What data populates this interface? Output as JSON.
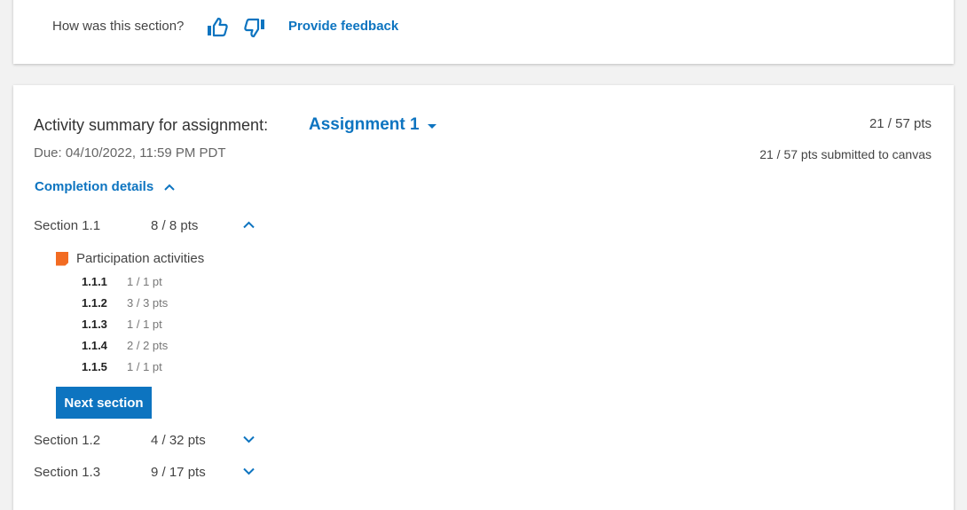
{
  "feedback": {
    "question": "How was this section?",
    "link": "Provide feedback"
  },
  "summary": {
    "label": "Activity summary for assignment:",
    "assignment": "Assignment 1",
    "total": "21 / 57 pts",
    "due": "Due: 04/10/2022, 11:59 PM PDT",
    "submitted": "21 / 57 pts submitted to canvas",
    "completion_toggle": "Completion details"
  },
  "sections": [
    {
      "name": "Section 1.1",
      "points": "8 / 8 pts",
      "expanded": true
    },
    {
      "name": "Section 1.2",
      "points": "4 / 32 pts",
      "expanded": false
    },
    {
      "name": "Section 1.3",
      "points": "9 / 17 pts",
      "expanded": false
    }
  ],
  "participation": {
    "title": "Participation activities",
    "icon_color": "#f26b22",
    "activities": [
      {
        "id": "1.1.1",
        "points": "1 / 1 pt"
      },
      {
        "id": "1.1.2",
        "points": "3 / 3 pts"
      },
      {
        "id": "1.1.3",
        "points": "1 / 1 pt"
      },
      {
        "id": "1.1.4",
        "points": "2 / 2 pts"
      },
      {
        "id": "1.1.5",
        "points": "1 / 1 pt"
      }
    ]
  },
  "next_button": "Next section",
  "colors": {
    "accent": "#0d74c0",
    "participation": "#f26b22"
  }
}
